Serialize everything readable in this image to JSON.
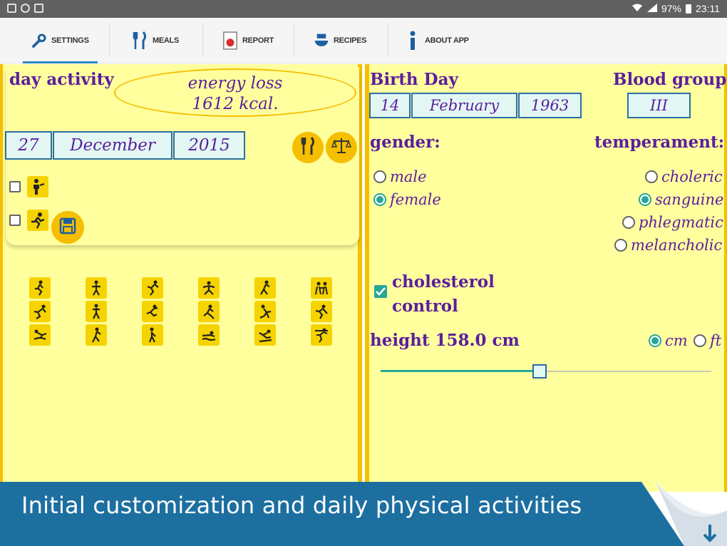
{
  "statusbar": {
    "battery": "97%",
    "time": "23:11"
  },
  "tabs": [
    {
      "label": "SETTINGS",
      "icon": "wrench-icon",
      "active": true
    },
    {
      "label": "MEALS",
      "icon": "fork-knife-icon",
      "active": false
    },
    {
      "label": "REPORT",
      "icon": "report-icon",
      "active": false
    },
    {
      "label": "RECIPES",
      "icon": "recipes-icon",
      "active": false
    },
    {
      "label": "ABOUT APP",
      "icon": "info-icon",
      "active": false
    }
  ],
  "left": {
    "title": "day activity",
    "energy_label": "energy loss",
    "energy_value": "1612 kcal.",
    "date": {
      "day": "27",
      "month": "December",
      "year": "2015"
    }
  },
  "right": {
    "birth_label": "Birth Day",
    "birth": {
      "day": "14",
      "month": "February",
      "year": "1963"
    },
    "blood_label": "Blood group",
    "blood_value": "III",
    "gender_label": "gender:",
    "gender_options": [
      "male",
      "female"
    ],
    "gender_selected": "female",
    "temperament_label": "temperament:",
    "temperament_options": [
      "choleric",
      "sanguine",
      "phlegmatic",
      "melancholic"
    ],
    "temperament_selected": "sanguine",
    "cholesterol_line1": "cholesterol",
    "cholesterol_line2": "control",
    "cholesterol_checked": true,
    "height_label": "height 158.0 cm",
    "unit_cm": "cm",
    "unit_ft": "ft",
    "unit_selected": "cm",
    "height_slider_fraction": 0.48
  },
  "banner": {
    "text": "Initial customization and daily physical activities"
  },
  "colors": {
    "panel": "#ffff9e",
    "accent": "#f5bf00",
    "text": "#5b1e9e",
    "banner": "#1d6fa0",
    "teal": "#26a69a"
  }
}
